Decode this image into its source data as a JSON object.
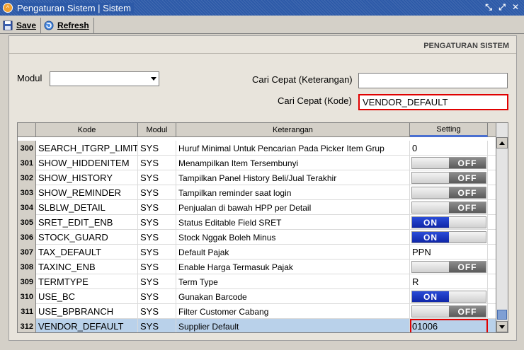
{
  "window": {
    "title": "Pengaturan Sistem | Sistem"
  },
  "toolbar": {
    "save_label": "Save",
    "refresh_label": "Refresh"
  },
  "panel": {
    "heading": "PENGATURAN SISTEM"
  },
  "filters": {
    "modul_label": "Modul",
    "modul_value": "",
    "cari_keterangan_label": "Cari Cepat (Keterangan)",
    "cari_keterangan_value": "",
    "cari_kode_label": "Cari Cepat (Kode)",
    "cari_kode_value": "VENDOR_DEFAULT"
  },
  "grid": {
    "columns": {
      "kode": "Kode",
      "modul": "Modul",
      "keterangan": "Keterangan",
      "setting": "Setting"
    },
    "rows": [
      {
        "no": "300",
        "kode": "SEARCH_ITGRP_LIMIT",
        "modul": "SYS",
        "keterangan": "Huruf Minimal Untuk Pencarian Pada Picker Item Grup",
        "setting_type": "text",
        "setting": "0"
      },
      {
        "no": "301",
        "kode": "SHOW_HIDDENITEM",
        "modul": "SYS",
        "keterangan": "Menampilkan Item Tersembunyi",
        "setting_type": "toggle",
        "setting": "OFF"
      },
      {
        "no": "302",
        "kode": "SHOW_HISTORY",
        "modul": "SYS",
        "keterangan": "Tampilkan Panel History Beli/Jual Terakhir",
        "setting_type": "toggle",
        "setting": "OFF"
      },
      {
        "no": "303",
        "kode": "SHOW_REMINDER",
        "modul": "SYS",
        "keterangan": "Tampilkan reminder saat login",
        "setting_type": "toggle",
        "setting": "OFF"
      },
      {
        "no": "304",
        "kode": "SLBLW_DETAIL",
        "modul": "SYS",
        "keterangan": "Penjualan di bawah HPP per Detail",
        "setting_type": "toggle",
        "setting": "OFF"
      },
      {
        "no": "305",
        "kode": "SRET_EDIT_ENB",
        "modul": "SYS",
        "keterangan": "Status Editable Field SRET",
        "setting_type": "toggle",
        "setting": "ON"
      },
      {
        "no": "306",
        "kode": "STOCK_GUARD",
        "modul": "SYS",
        "keterangan": "Stock Nggak Boleh Minus",
        "setting_type": "toggle",
        "setting": "ON"
      },
      {
        "no": "307",
        "kode": "TAX_DEFAULT",
        "modul": "SYS",
        "keterangan": "Default Pajak",
        "setting_type": "text",
        "setting": "PPN"
      },
      {
        "no": "308",
        "kode": "TAXINC_ENB",
        "modul": "SYS",
        "keterangan": "Enable Harga Termasuk Pajak",
        "setting_type": "toggle",
        "setting": "OFF"
      },
      {
        "no": "309",
        "kode": "TERMTYPE",
        "modul": "SYS",
        "keterangan": "Term Type",
        "setting_type": "text",
        "setting": "R"
      },
      {
        "no": "310",
        "kode": "USE_BC",
        "modul": "SYS",
        "keterangan": "Gunakan Barcode",
        "setting_type": "toggle",
        "setting": "ON"
      },
      {
        "no": "311",
        "kode": "USE_BPBRANCH",
        "modul": "SYS",
        "keterangan": "Filter Customer Cabang",
        "setting_type": "toggle",
        "setting": "OFF"
      },
      {
        "no": "312",
        "kode": "VENDOR_DEFAULT",
        "modul": "SYS",
        "keterangan": "Supplier Default",
        "setting_type": "text",
        "setting": "01006",
        "selected": true
      }
    ]
  },
  "colors": {
    "highlight_red": "#e00000",
    "toggle_on": "#1a35c0",
    "toggle_off": "#6a6a6a",
    "selected_row": "#b9d1ea",
    "title_bar": "#2d5aa8"
  }
}
